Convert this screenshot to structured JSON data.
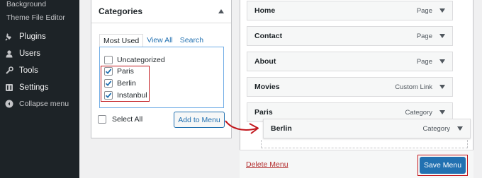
{
  "sidebar": {
    "sub_items": [
      "Background",
      "Theme File Editor"
    ],
    "nav_items": [
      {
        "label": "Plugins",
        "icon": "plugin-icon"
      },
      {
        "label": "Users",
        "icon": "users-icon"
      },
      {
        "label": "Tools",
        "icon": "tools-icon"
      },
      {
        "label": "Settings",
        "icon": "settings-icon"
      }
    ],
    "collapse_label": "Collapse menu"
  },
  "categories_panel": {
    "title": "Categories",
    "tabs": [
      "Most Used",
      "View All",
      "Search"
    ],
    "items": [
      {
        "label": "Uncategorized",
        "checked": false
      },
      {
        "label": "Paris",
        "checked": true
      },
      {
        "label": "Berlin",
        "checked": true
      },
      {
        "label": "Instanbul",
        "checked": true
      }
    ],
    "select_all_label": "Select All",
    "add_button": "Add to Menu"
  },
  "menu_structure": {
    "items": [
      {
        "title": "Home",
        "type": "Page"
      },
      {
        "title": "Contact",
        "type": "Page"
      },
      {
        "title": "About",
        "type": "Page"
      },
      {
        "title": "Movies",
        "type": "Custom Link"
      },
      {
        "title": "Paris",
        "type": "Category"
      },
      {
        "title": "Berlin",
        "type": "Category"
      }
    ],
    "delete_label": "Delete Menu",
    "save_button": "Save Menu"
  },
  "colors": {
    "sidebar_bg": "#1d2327",
    "accent": "#2271b1",
    "highlight": "#c2171d",
    "delete": "#b32d2e"
  }
}
